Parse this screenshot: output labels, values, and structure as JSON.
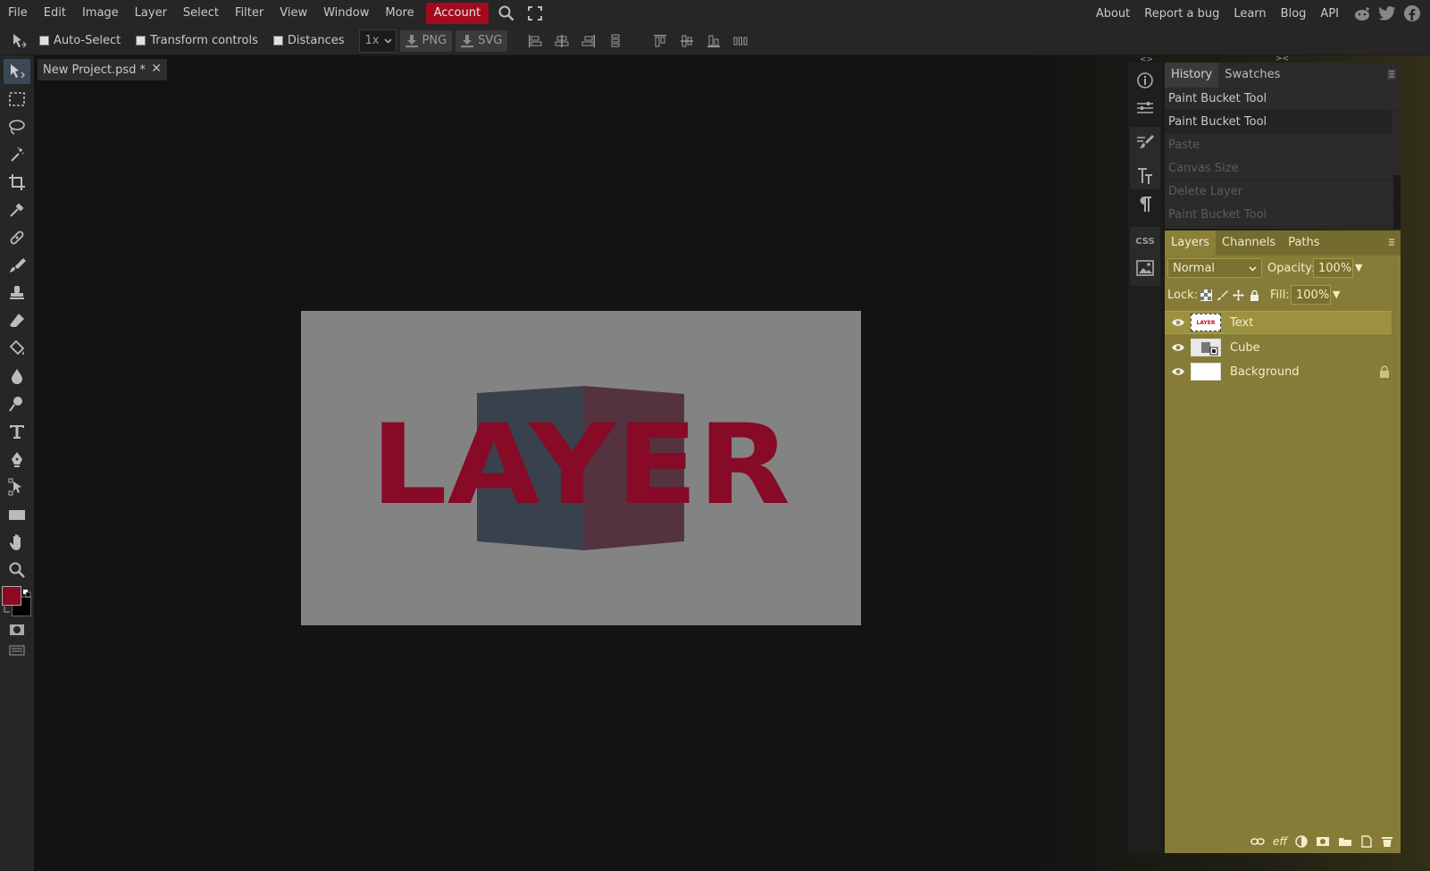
{
  "menubar": {
    "items": [
      "File",
      "Edit",
      "Image",
      "Layer",
      "Select",
      "Filter",
      "View",
      "Window",
      "More"
    ],
    "account": "Account",
    "right_links": [
      "About",
      "Report a bug",
      "Learn",
      "Blog",
      "API"
    ]
  },
  "optionsbar": {
    "auto_select": "Auto-Select",
    "transform_controls": "Transform controls",
    "distances": "Distances",
    "scale": "1x",
    "png": "PNG",
    "svg": "SVG"
  },
  "document": {
    "tab_title": "New Project.psd *",
    "canvas_text": "LAYER"
  },
  "side_icons": {
    "css": "CSS"
  },
  "history": {
    "tabs": [
      "History",
      "Swatches"
    ],
    "items": [
      "Paint Bucket Tool",
      "Paint Bucket Tool",
      "Paste",
      "Canvas Size",
      "Delete Layer",
      "Paint Bucket Tool"
    ]
  },
  "layers_panel": {
    "tabs": [
      "Layers",
      "Channels",
      "Paths"
    ],
    "blend_mode": "Normal",
    "opacity_label": "Opacity:",
    "opacity_value": "100%",
    "lock_label": "Lock:",
    "fill_label": "Fill:",
    "fill_value": "100%",
    "layers": [
      "Text",
      "Cube",
      "Background"
    ],
    "thumb_text": "LAYER",
    "footer": {
      "effects_label": "eff"
    }
  },
  "colors": {
    "foreground": "#8b0a22",
    "background": "#000000",
    "account_bg": "#a10b1c",
    "layers_panel_bg": "#867c37"
  }
}
